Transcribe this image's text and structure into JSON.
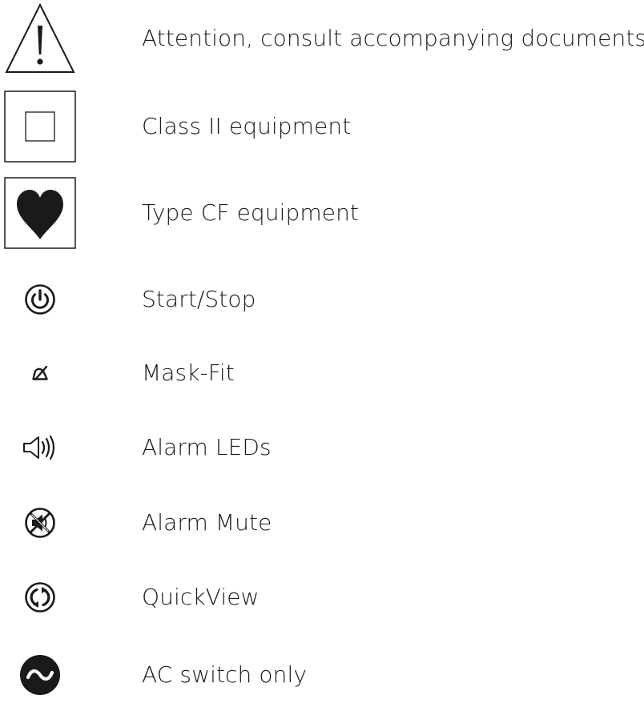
{
  "symbols": [
    {
      "icon": "warning-triangle-icon",
      "label": "Attention, consult accompanying documents"
    },
    {
      "icon": "double-square-icon",
      "label": "Class II equipment"
    },
    {
      "icon": "heart-icon",
      "label": "Type CF equipment"
    },
    {
      "icon": "power-icon",
      "label": "Start/Stop"
    },
    {
      "icon": "mask-fit-icon",
      "label": "Mask-Fit"
    },
    {
      "icon": "speaker-icon",
      "label": "Alarm LEDs"
    },
    {
      "icon": "mute-icon",
      "label": "Alarm Mute"
    },
    {
      "icon": "quickview-icon",
      "label": "QuickView"
    },
    {
      "icon": "ac-switch-icon",
      "label": "AC switch only"
    }
  ],
  "colors": {
    "ink": "#1a1a1a",
    "background": "#ffffff"
  }
}
